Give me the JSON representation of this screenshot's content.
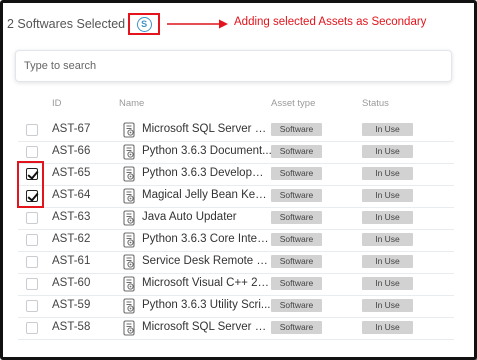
{
  "header": {
    "selected_text": "2 Softwares Selected",
    "badge": "S",
    "annotation": "Adding selected Assets as Secondary"
  },
  "search": {
    "placeholder": "Type to search"
  },
  "columns": {
    "id": "ID",
    "name": "Name",
    "asset_type": "Asset type",
    "status": "Status"
  },
  "rows": [
    {
      "checked": false,
      "id": "AST-67",
      "name": "Microsoft SQL Server 20...",
      "type": "Software",
      "status": "In Use"
    },
    {
      "checked": false,
      "id": "AST-66",
      "name": "Python 3.6.3 Document...",
      "type": "Software",
      "status": "In Use"
    },
    {
      "checked": true,
      "id": "AST-65",
      "name": "Python 3.6.3 Developme...",
      "type": "Software",
      "status": "In Use"
    },
    {
      "checked": true,
      "id": "AST-64",
      "name": "Magical Jelly Bean KeyFi...",
      "type": "Software",
      "status": "In Use"
    },
    {
      "checked": false,
      "id": "AST-63",
      "name": "Java Auto Updater",
      "type": "Software",
      "status": "In Use"
    },
    {
      "checked": false,
      "id": "AST-62",
      "name": "Python 3.6.3 Core Interp...",
      "type": "Software",
      "status": "In Use"
    },
    {
      "checked": false,
      "id": "AST-61",
      "name": "Service Desk Remote Se...",
      "type": "Software",
      "status": "In Use"
    },
    {
      "checked": false,
      "id": "AST-60",
      "name": "Microsoft Visual C++ 20...",
      "type": "Software",
      "status": "In Use"
    },
    {
      "checked": false,
      "id": "AST-59",
      "name": "Python 3.6.3 Utility Scri...",
      "type": "Software",
      "status": "In Use"
    },
    {
      "checked": false,
      "id": "AST-58",
      "name": "Microsoft SQL Server 20...",
      "type": "Software",
      "status": "In Use"
    }
  ],
  "icons": {
    "row_icon": "software-icon",
    "checkbox": "checkbox-icon",
    "badge": "secondary-badge-icon",
    "arrow": "arrow-right-icon"
  },
  "colors": {
    "annotation": "#e3141c",
    "badge": "#3f93c7",
    "tag_bg": "#d2d2d2"
  }
}
